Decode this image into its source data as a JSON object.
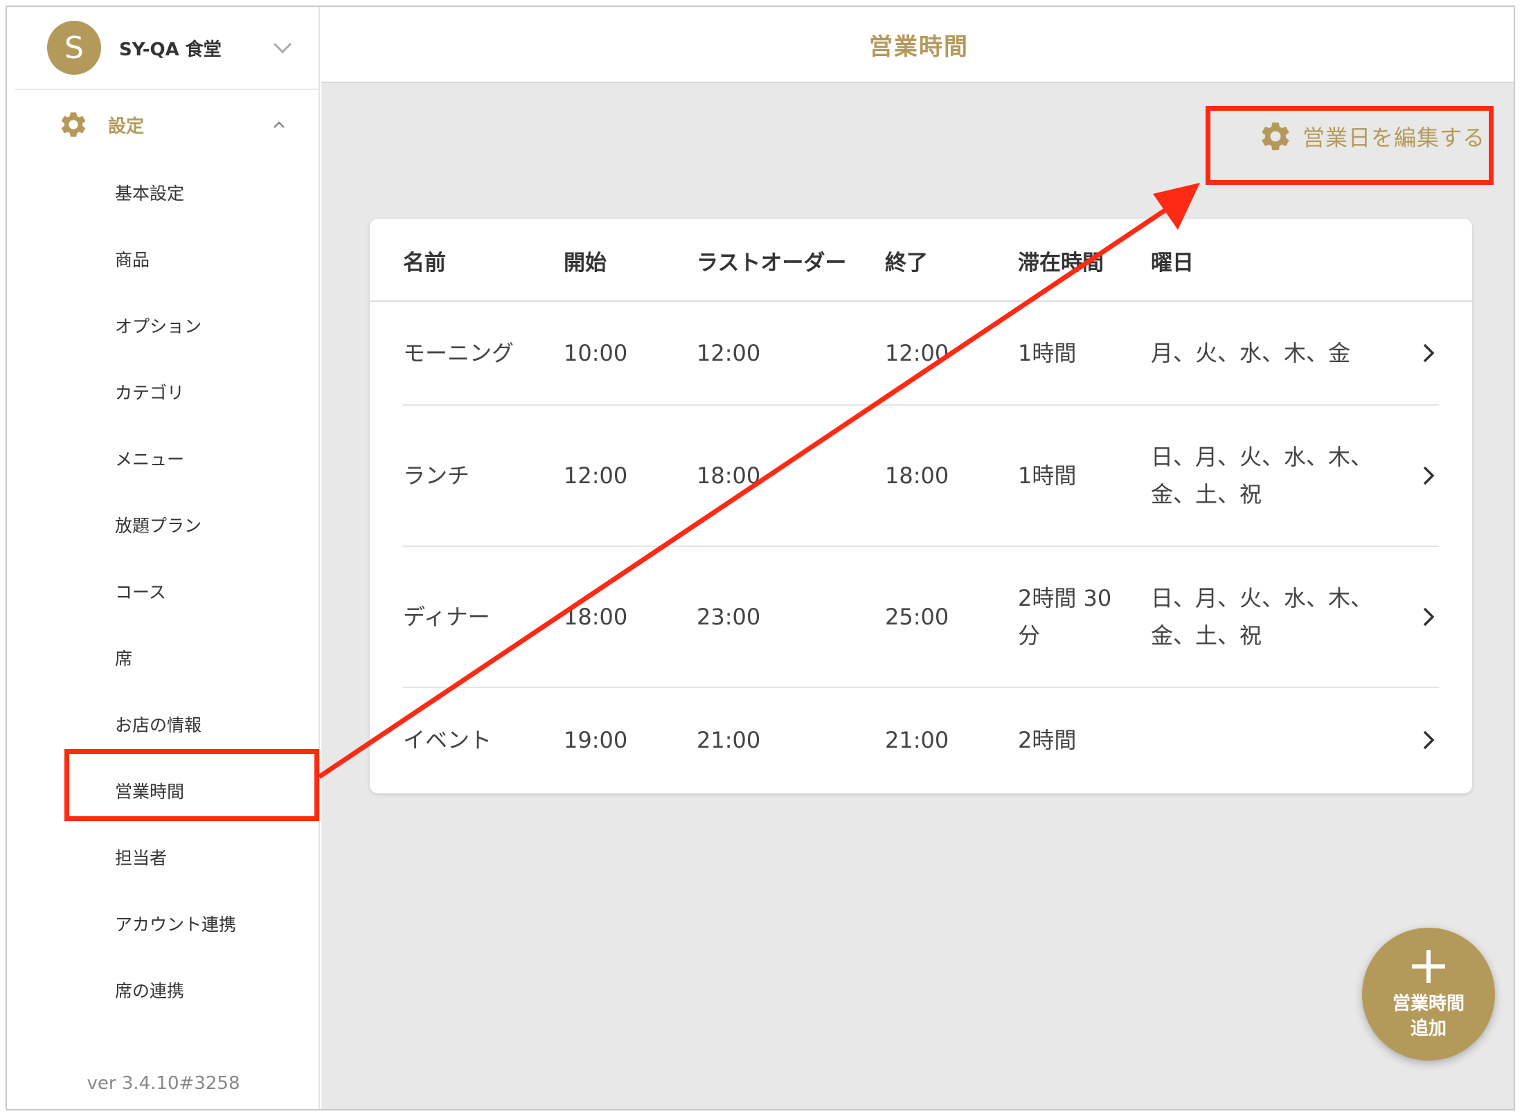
{
  "sidebar": {
    "avatar_letter": "S",
    "store_name": "SY-QA 食堂",
    "settings_label": "設定",
    "items": [
      {
        "label": "基本設定"
      },
      {
        "label": "商品"
      },
      {
        "label": "オプション"
      },
      {
        "label": "カテゴリ"
      },
      {
        "label": "メニュー"
      },
      {
        "label": "放題プラン"
      },
      {
        "label": "コース"
      },
      {
        "label": "席"
      },
      {
        "label": "お店の情報"
      },
      {
        "label": "営業時間"
      },
      {
        "label": "担当者"
      },
      {
        "label": "アカウント連携"
      },
      {
        "label": "席の連携"
      }
    ],
    "version": "ver 3.4.10#3258"
  },
  "header": {
    "title": "営業時間"
  },
  "edit_days_button": {
    "label": "営業日を編集する",
    "icon": "gear-icon"
  },
  "table": {
    "columns": [
      "名前",
      "開始",
      "ラストオーダー",
      "終了",
      "滞在時間",
      "曜日"
    ],
    "rows": [
      {
        "name": "モーニング",
        "start": "10:00",
        "last_order": "12:00",
        "end": "12:00",
        "stay": "1時間",
        "days": "月、火、水、木、金"
      },
      {
        "name": "ランチ",
        "start": "12:00",
        "last_order": "18:00",
        "end": "18:00",
        "stay": "1時間",
        "days": "日、月、火、水、木、\n金、土、祝"
      },
      {
        "name": "ディナー",
        "start": "18:00",
        "last_order": "23:00",
        "end": "25:00",
        "stay": "2時間 30\n分",
        "days": "日、月、火、水、木、\n金、土、祝"
      },
      {
        "name": "イベント",
        "start": "19:00",
        "last_order": "21:00",
        "end": "21:00",
        "stay": "2時間",
        "days": ""
      }
    ]
  },
  "fab": {
    "line1": "営業時間",
    "line2": "追加",
    "icon": "plus-icon"
  },
  "colors": {
    "accent": "#b49a5a",
    "annotation": "#ff2a13",
    "background": "#e8e8e8"
  }
}
